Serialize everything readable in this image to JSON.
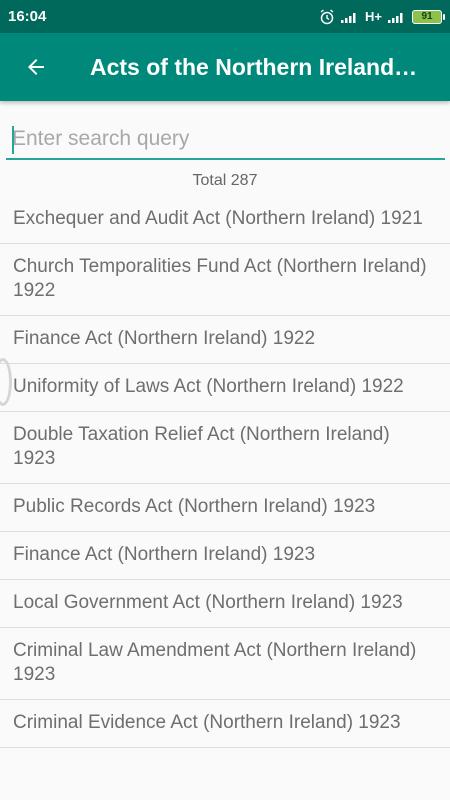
{
  "status_bar": {
    "time": "16:04",
    "network_type": "H+",
    "battery": "91",
    "icons": [
      "alarm-icon",
      "signal-icon",
      "battery-icon"
    ]
  },
  "app_bar": {
    "title": "Acts of the Northern Ireland…",
    "back_icon": "arrow-left-icon"
  },
  "search": {
    "placeholder": "Enter search query",
    "value": ""
  },
  "total_label": "Total 287",
  "items": [
    "Exchequer and Audit Act (Northern Ireland) 1921",
    "Church Temporalities Fund Act (Northern Ireland) 1922",
    "Finance Act (Northern Ireland) 1922",
    "Uniformity of Laws Act (Northern Ireland) 1922",
    "Double Taxation Relief Act (Northern Ireland) 1923",
    "Public Records Act (Northern Ireland) 1923",
    "Finance Act (Northern Ireland) 1923",
    "Local Government Act (Northern Ireland) 1923",
    "Criminal Law Amendment Act (Northern Ireland) 1923",
    "Criminal Evidence Act (Northern Ireland) 1923"
  ],
  "colors": {
    "status_bar": "#00695c",
    "app_bar": "#00897b",
    "accent": "#26a69a"
  }
}
